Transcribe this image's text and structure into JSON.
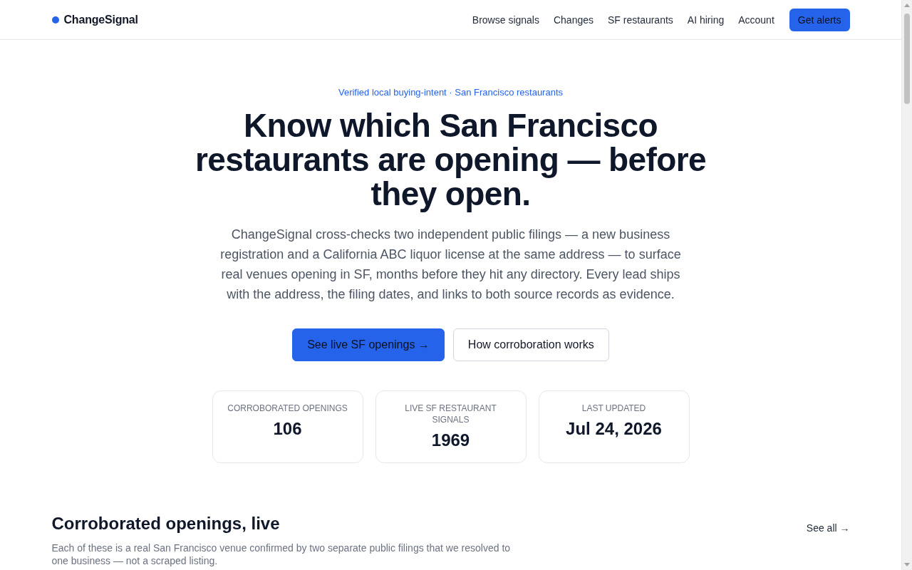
{
  "header": {
    "logo": "ChangeSignal",
    "nav": [
      "Browse signals",
      "Changes",
      "SF restaurants",
      "AI hiring",
      "Account"
    ],
    "cta": "Get alerts"
  },
  "hero": {
    "eyebrow": "Verified local buying-intent · San Francisco restaurants",
    "headline": "Know which San Francisco restaurants are opening — before they open.",
    "lede": "ChangeSignal cross-checks two independent public filings — a new business registration and a California ABC liquor license at the same address — to surface real venues opening in SF, months before they hit any directory. Every lead ships with the address, the filing dates, and links to both source records as evidence.",
    "buttons": [
      {
        "label": "See live SF openings →",
        "kind": "primary"
      },
      {
        "label": "How corroboration works",
        "kind": "secondary"
      }
    ],
    "stats": [
      {
        "label": "CORROBORATED OPENINGS",
        "value": "106"
      },
      {
        "label": "LIVE SF RESTAURANT SIGNALS",
        "value": "1969"
      },
      {
        "label": "LAST UPDATED",
        "value": "Jul 24, 2026"
      }
    ]
  },
  "section": {
    "title": "Corroborated openings, live",
    "link": "See all →",
    "description": "Each of these is a real San Francisco venue confirmed by two separate public filings that we resolved to one business — not a scraped listing."
  }
}
